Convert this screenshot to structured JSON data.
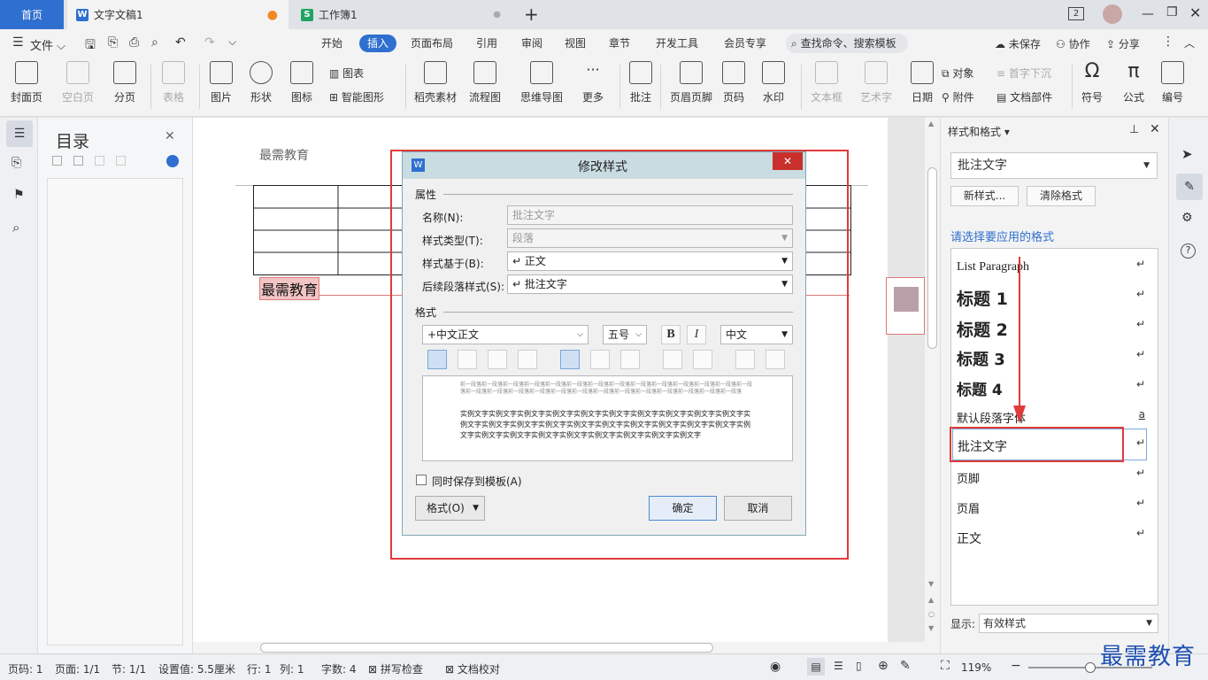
{
  "tabs": {
    "home": "首页",
    "doc": "文字文稿1",
    "sheet": "工作簿1",
    "new_tab": "+",
    "badge": "2"
  },
  "menu": {
    "file": "文件",
    "items": [
      "开始",
      "插入",
      "页面布局",
      "引用",
      "审阅",
      "视图",
      "章节",
      "开发工具",
      "会员专享"
    ],
    "active": "插入",
    "search": "查找命令、搜索模板",
    "unsaved": "未保存",
    "collab": "协作",
    "share": "分享"
  },
  "ribbon": {
    "cover": "封面页",
    "blank": "空白页",
    "pagebreak": "分页",
    "table": "表格",
    "image": "图片",
    "shape": "形状",
    "icon": "图标",
    "chart": "图表",
    "smartart": "智能图形",
    "material": "稻壳素材",
    "flowchart": "流程图",
    "mindmap": "思维导图",
    "more": "更多",
    "comment": "批注",
    "headerfooter": "页眉页脚",
    "pagenum": "页码",
    "watermark": "水印",
    "textbox": "文本框",
    "wordart": "艺术字",
    "date": "日期",
    "object": "对象",
    "dropcap": "首字下沉",
    "attachment": "附件",
    "docpart": "文档部件",
    "symbol": "符号",
    "formula": "公式",
    "numbering": "编号"
  },
  "toc": {
    "title": "目录"
  },
  "document": {
    "header_text": "最需教育",
    "comment_text": "最需教育"
  },
  "dialog": {
    "title": "修改样式",
    "section_props": "属性",
    "name_label": "名称(N):",
    "name_value": "批注文字",
    "type_label": "样式类型(T):",
    "type_value": "段落",
    "based_label": "样式基于(B):",
    "based_value": "↵ 正文",
    "next_label": "后续段落样式(S):",
    "next_value": "↵ 批注文字",
    "section_format": "格式",
    "font": "+中文正文",
    "size": "五号",
    "bold": "B",
    "italic": "I",
    "lang": "中文",
    "preview_prev": "前一段落前一段落前一段落前一段落前一段落前一段落前一段落前一段落前一段落前一段落前一段落前一段落前一段落前一段落前一段落前一段落前一段落前一段落前一段落前一段落前一段落前一段落前一段落前一段落前一段落前一段落前一段落",
    "preview_sample": "实例文字实例文字实例文字实例文字实例文字实例文字实例文字实例文字实例文字实例文字实例文字实例文字实例文字实例文字实例文字实例文字实例文字实例文字实例文字实例文字实例文字实例文字实例文字实例文字实例文字实例文字实例文字实例文字实例文字",
    "save_template": "同时保存到模板(A)",
    "format_btn": "格式(O)",
    "ok": "确定",
    "cancel": "取消"
  },
  "styles_panel": {
    "title": "样式和格式",
    "current": "批注文字",
    "new_style": "新样式...",
    "clear": "清除格式",
    "apply_label": "请选择要应用的格式",
    "items": [
      "List Paragraph",
      "标题 1",
      "标题 2",
      "标题 3",
      "标题 4",
      "默认段落字体",
      "批注文字",
      "页脚",
      "页眉",
      "正文"
    ],
    "show_label": "显示:",
    "show_value": "有效样式"
  },
  "status": {
    "page": "页码: 1",
    "pages": "页面: 1/1",
    "section": "节: 1/1",
    "setting": "设置值: 5.5厘米",
    "row": "行: 1",
    "col": "列: 1",
    "words": "字数: 4",
    "spell": "拼写检查",
    "proof": "文档校对",
    "zoom": "119%",
    "watermark": "最需教育"
  },
  "colors": {
    "accent": "#1e6fc4",
    "highlight_red": "#e03a3a"
  }
}
